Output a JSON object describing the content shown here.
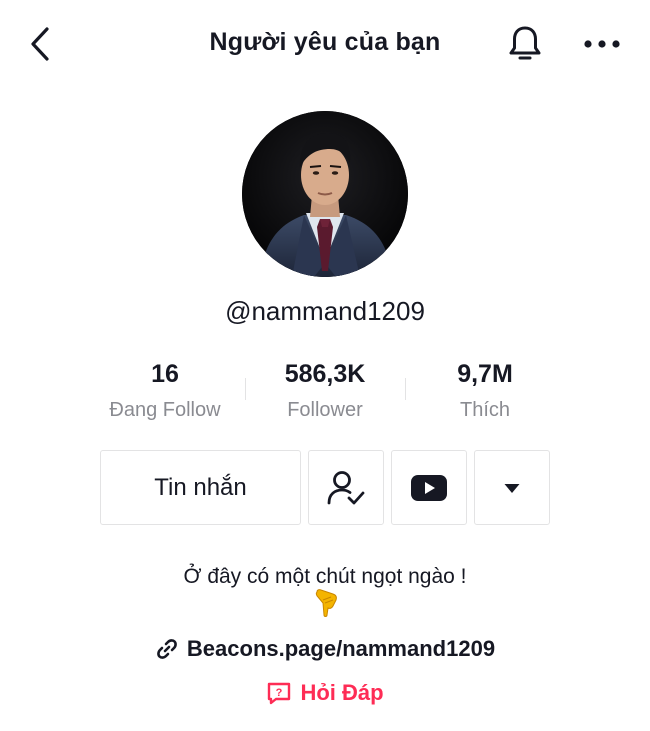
{
  "header": {
    "title": "Người yêu của bạn",
    "back_icon": "chevron-left-icon",
    "bell_icon": "bell-icon",
    "more_icon": "more-horizontal-icon"
  },
  "profile": {
    "username": "@nammand1209",
    "avatar": "profile-photo"
  },
  "stats": [
    {
      "value": "16",
      "label": "Đang Follow"
    },
    {
      "value": "586,3K",
      "label": "Follower"
    },
    {
      "value": "9,7M",
      "label": "Thích"
    }
  ],
  "actions": {
    "message_label": "Tin nhắn",
    "follow_icon": "user-check-icon",
    "youtube_icon": "youtube-icon",
    "dropdown_icon": "caret-down-icon"
  },
  "bio": {
    "text": "Ở đây có một chút ngọt ngào !",
    "emoji": "pointing-down-hand-emoji"
  },
  "link": {
    "text": "Beacons.page/nammand1209",
    "icon": "link-icon"
  },
  "qa": {
    "text": "Hỏi Đáp",
    "icon": "question-bubble-icon",
    "color": "#fe2c55"
  },
  "colors": {
    "text": "#161823",
    "secondary": "#8a8b91",
    "border": "#e3e3e4",
    "accent": "#fe2c55"
  }
}
